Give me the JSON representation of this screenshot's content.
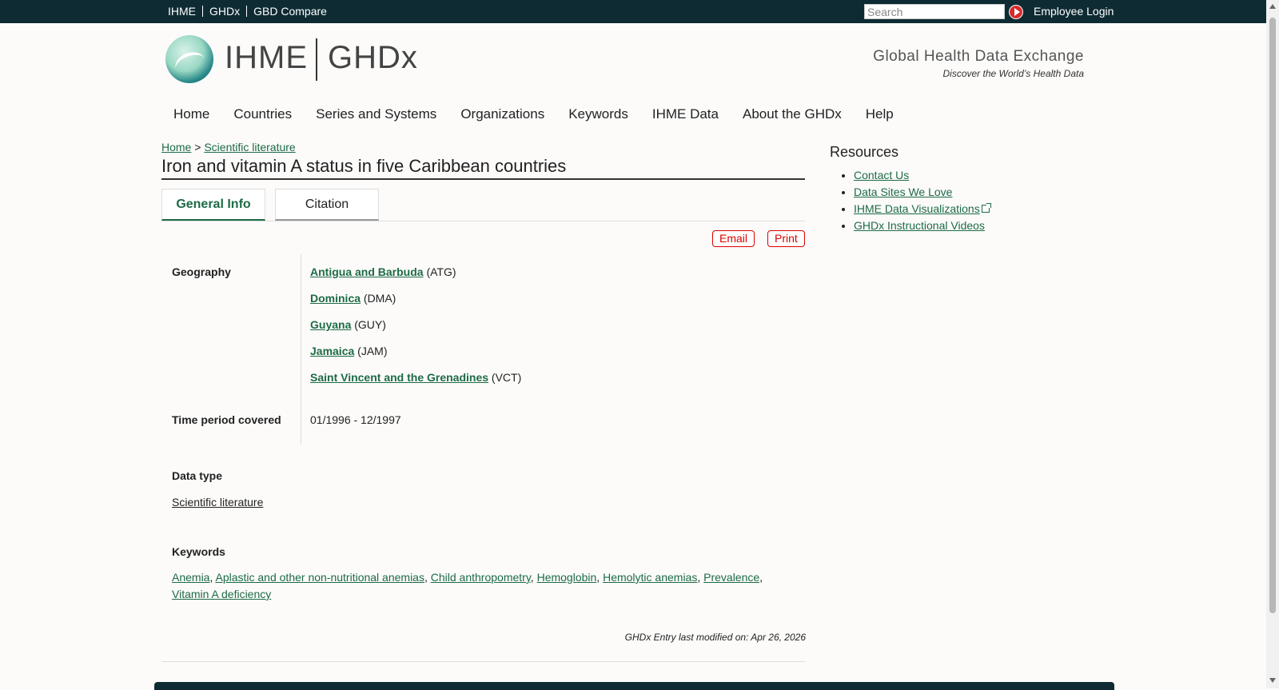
{
  "topbar": {
    "links": [
      "IHME",
      "GHDx",
      "GBD Compare"
    ],
    "search_placeholder": "Search",
    "employee_login": "Employee Login"
  },
  "header": {
    "logo_ihme": "IHME",
    "logo_ghdx": "GHDx",
    "tagline_title": "Global Health Data Exchange",
    "tagline_sub": "Discover the World’s Health Data"
  },
  "nav": [
    "Home",
    "Countries",
    "Series and Systems",
    "Organizations",
    "Keywords",
    "IHME Data",
    "About the GHDx",
    "Help"
  ],
  "breadcrumb": {
    "home": "Home",
    "sep": ">",
    "section": "Scientific literature"
  },
  "page_title": "Iron and vitamin A status in five Caribbean countries",
  "tabs": {
    "general": "General Info",
    "citation": "Citation"
  },
  "actions": {
    "email": "Email",
    "print": "Print"
  },
  "geography": {
    "label": "Geography",
    "items": [
      {
        "name": "Antigua and Barbuda",
        "code": "(ATG)"
      },
      {
        "name": "Dominica",
        "code": "(DMA)"
      },
      {
        "name": "Guyana",
        "code": "(GUY)"
      },
      {
        "name": "Jamaica",
        "code": "(JAM)"
      },
      {
        "name": "Saint Vincent and the Grenadines",
        "code": "(VCT)"
      }
    ]
  },
  "time_period": {
    "label": "Time period covered",
    "value": "01/1996 - 12/1997"
  },
  "data_type": {
    "label": "Data type",
    "value": "Scientific literature"
  },
  "keywords": {
    "label": "Keywords",
    "items": [
      "Anemia",
      "Aplastic and other non-nutritional anemias",
      "Child anthropometry",
      "Hemoglobin",
      "Hemolytic anemias",
      "Prevalence",
      "Vitamin A deficiency"
    ]
  },
  "modified": "GHDx Entry last modified on: Apr 26, 2026",
  "resources": {
    "title": "Resources",
    "items": [
      "Contact Us",
      "Data Sites We Love",
      "IHME Data Visualizations",
      "GHDx Instructional Videos"
    ]
  }
}
